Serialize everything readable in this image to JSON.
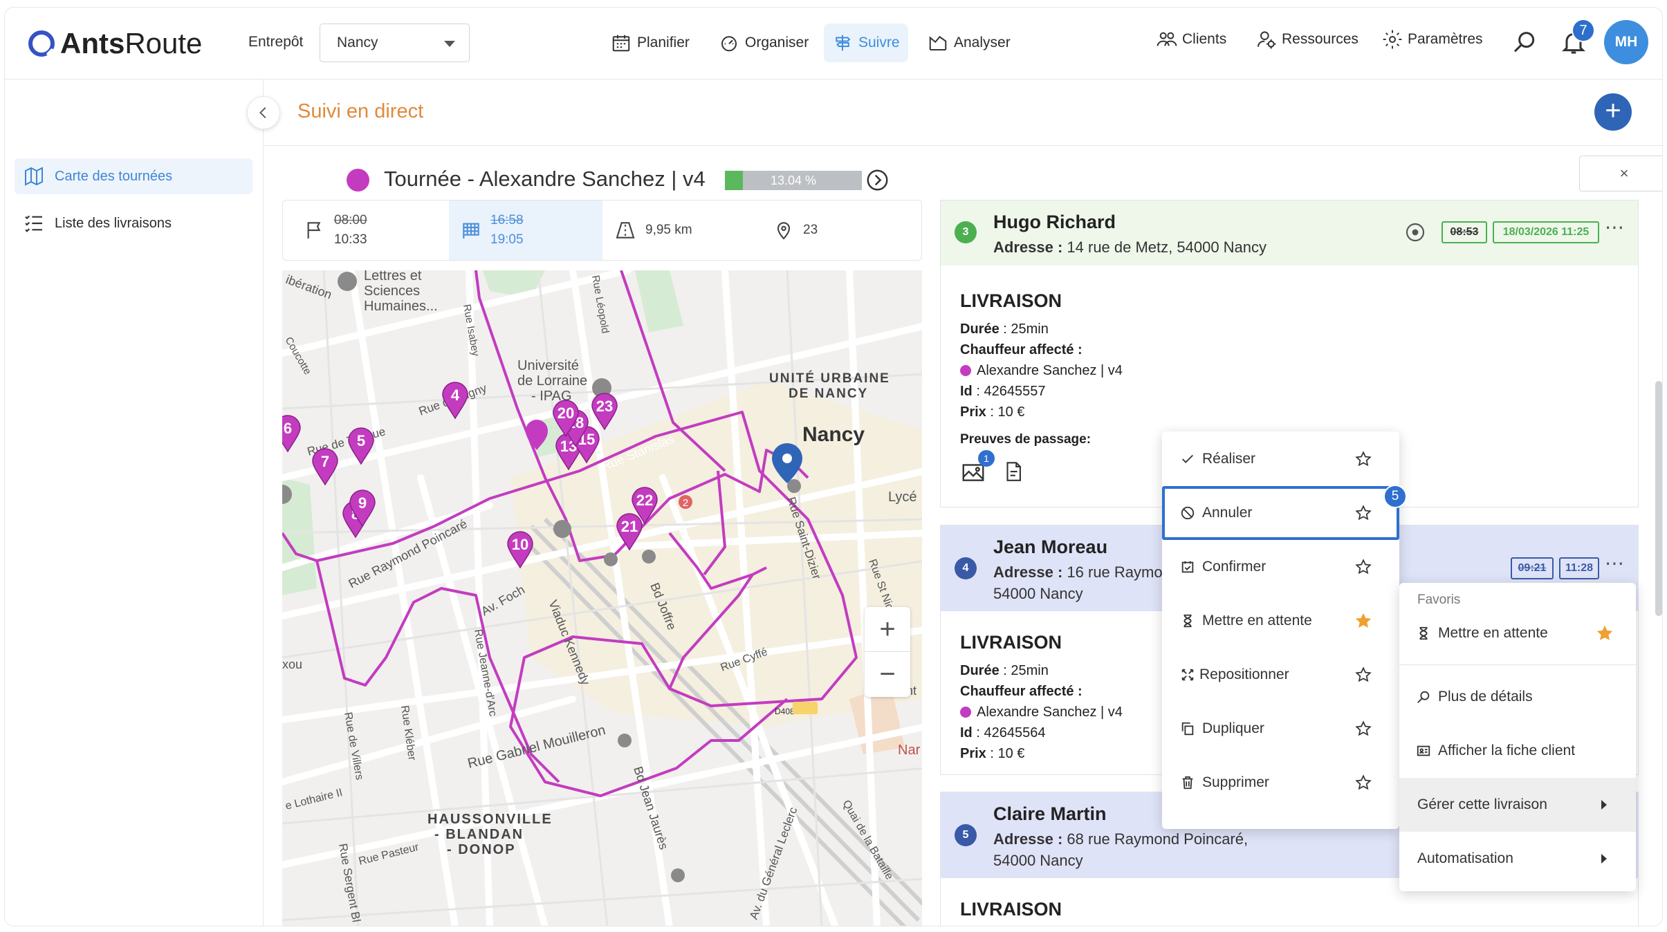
{
  "app": {
    "brand_light": "Ants",
    "brand_bold": "Route"
  },
  "header": {
    "warehouse_label": "Entrepôt",
    "warehouse_value": "Nancy",
    "nav": [
      {
        "label": "Planifier",
        "icon": "calendar-icon"
      },
      {
        "label": "Organiser",
        "icon": "gauge-icon"
      },
      {
        "label": "Suivre",
        "icon": "signpost-icon",
        "active": true
      },
      {
        "label": "Analyser",
        "icon": "chart-icon"
      }
    ],
    "right_nav": [
      {
        "label": "Clients",
        "icon": "users-icon"
      },
      {
        "label": "Ressources",
        "icon": "user-gear-icon"
      },
      {
        "label": "Paramètres",
        "icon": "gear-icon"
      }
    ],
    "notification_count": "7",
    "avatar_initials": "MH"
  },
  "sidebar": {
    "items": [
      {
        "label": "Carte des tournées",
        "icon": "map-icon",
        "active": true
      },
      {
        "label": "Liste des livraisons",
        "icon": "list-icon"
      }
    ]
  },
  "page": {
    "title": "Suivi en direct",
    "close_label": "×"
  },
  "tour": {
    "title": "Tournée - Alexandre Sanchez | v4",
    "color": "#c33cc0",
    "progress_label": "13.04 %",
    "progress_fraction": 0.1304
  },
  "stats": {
    "start_planned": "08:00",
    "start_actual": "10:33",
    "end_planned": "16:58",
    "end_actual": "19:05",
    "distance": "9,95 km",
    "stops": "23"
  },
  "map": {
    "labels": [
      {
        "text": "Lettres et"
      },
      {
        "text": "Sciences"
      },
      {
        "text": "Humaines..."
      },
      {
        "text": "Université"
      },
      {
        "text": "de Lorraine"
      },
      {
        "text": "- IPAG"
      },
      {
        "text": "UNITÉ URBAINE"
      },
      {
        "text": "DE NANCY"
      },
      {
        "text": "Nancy"
      },
      {
        "text": "Lycé"
      },
      {
        "text": "Rue de Rigny"
      },
      {
        "text": "Rue de Turique"
      },
      {
        "text": "Rue Stanislas"
      },
      {
        "text": "Rue Raymond Poincaré"
      },
      {
        "text": "Av. Foch"
      },
      {
        "text": "Viaduc Kennedy"
      },
      {
        "text": "Bd Joffre"
      },
      {
        "text": "Rue Jeanne-d'Arc"
      },
      {
        "text": "Rue Gabriel Mouilleron"
      },
      {
        "text": "Bd Jean Jaurès"
      },
      {
        "text": "Rue Saint-Dizier"
      },
      {
        "text": "Rue Cyffé"
      },
      {
        "text": "HAUSSONVILLE"
      },
      {
        "text": "- BLANDAN"
      },
      {
        "text": "- DONOP"
      },
      {
        "text": "Rue Pasteur"
      },
      {
        "text": "Rue Sergent Bl"
      },
      {
        "text": "Rue Kléber"
      },
      {
        "text": "Rue de Villers"
      },
      {
        "text": "e Lothaire II"
      },
      {
        "text": "Av. du Général Leclerc"
      },
      {
        "text": "Quai de la Bataille"
      },
      {
        "text": "Rue St Nicolas"
      },
      {
        "text": "Rue Isabey"
      },
      {
        "text": "Rue Léopold"
      },
      {
        "text": "ibération"
      },
      {
        "text": "Coucotte"
      },
      {
        "text": "xou"
      },
      {
        "text": "Nar"
      },
      {
        "text": "D408"
      },
      {
        "text": "nt"
      },
      {
        "text": "Rue Sa"
      }
    ],
    "markers": [
      "4",
      "5",
      "6",
      "7",
      "8",
      "9",
      "10",
      "13",
      "15",
      "18",
      "20",
      "21",
      "22",
      "23"
    ],
    "cluster_badge": "2",
    "zoom_in": "+",
    "zoom_out": "−"
  },
  "cards": [
    {
      "number": "3",
      "name": "Hugo Richard",
      "address_label": "Adresse :",
      "address": "14 rue de Metz, 54000 Nancy",
      "time_planned": "08:53",
      "time_actual": "18/03/2026 11:25",
      "header_color": "#eef7ea",
      "badge_color": "#4caf50",
      "time_color": "#4caf50",
      "section": "LIVRAISON",
      "duration_label": "Durée",
      "duration": "25min",
      "driver_label": "Chauffeur affecté :",
      "driver": "Alexandre Sanchez | v4",
      "id_label": "Id",
      "id": "42645557",
      "price_label": "Prix",
      "price": "10 €",
      "proofs_label": "Preuves de passage:",
      "photo_count": "1"
    },
    {
      "number": "4",
      "name": "Jean Moreau",
      "address_label": "Adresse :",
      "address_line1": "16 rue Raymo",
      "address_line2": "54000 Nancy",
      "time_planned": "09:21",
      "time_actual": "11:28",
      "header_color": "#dfe3f7",
      "badge_color": "#3a5aa8",
      "time_color": "#3a5aa8",
      "section": "LIVRAISON",
      "duration_label": "Durée",
      "duration": "25min",
      "driver_label": "Chauffeur affecté :",
      "driver": "Alexandre Sanchez | v4",
      "id_label": "Id",
      "id": "42645564",
      "price_label": "Prix",
      "price": "10 €"
    },
    {
      "number": "5",
      "name": "Claire Martin",
      "address_label": "Adresse :",
      "address_line1": "68 rue Raymond Poincaré,",
      "address_line2": "54000 Nancy",
      "header_color": "#dfe3f7",
      "badge_color": "#3a5aa8",
      "section": "LIVRAISON"
    }
  ],
  "context_menu": {
    "items": [
      {
        "label": "Réaliser",
        "icon": "check-icon",
        "starred": false
      },
      {
        "label": "Annuler",
        "icon": "ban-icon",
        "starred": false,
        "focused": true
      },
      {
        "label": "Confirmer",
        "icon": "calendar-check-icon",
        "starred": false
      },
      {
        "label": "Mettre en attente",
        "icon": "hourglass-icon",
        "starred": true
      },
      {
        "label": "Repositionner",
        "icon": "move-icon",
        "starred": false
      },
      {
        "label": "Dupliquer",
        "icon": "copy-icon",
        "starred": false
      },
      {
        "label": "Supprimer",
        "icon": "trash-icon",
        "starred": false
      }
    ],
    "focus_badge": "5"
  },
  "submenu": {
    "favorites_label": "Favoris",
    "items": [
      {
        "label": "Mettre en attente",
        "icon": "hourglass-icon",
        "starred": true
      },
      {
        "label": "Plus de détails",
        "icon": "magnifier-icon"
      },
      {
        "label": "Afficher la fiche client",
        "icon": "id-card-icon"
      },
      {
        "label": "Gérer cette livraison",
        "has_arrow": true,
        "active": true
      },
      {
        "label": "Automatisation",
        "has_arrow": true
      }
    ]
  },
  "colors": {
    "accent": "#3d8ede",
    "primary_dark": "#2f65b6",
    "title_orange": "#e08a3c",
    "route": "#c33cc0",
    "star": "#f0a030"
  }
}
